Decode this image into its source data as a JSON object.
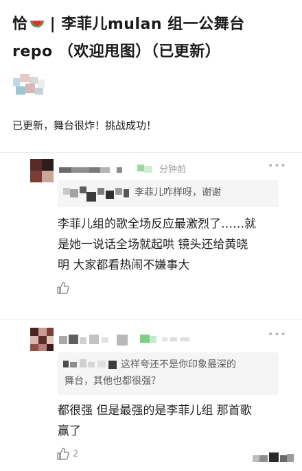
{
  "post": {
    "title_line1_pre": "恰",
    "title_line1_post": " | 李菲儿mulan 组一公舞台",
    "title_line2": "repo （欢迎甩图）（已更新）",
    "melon_icon": "watermelon-icon",
    "update_text": "已更新，舞台很炸！挑战成功！"
  },
  "comments": [
    {
      "time": "分钟前",
      "quote": "李菲儿咋样呀，谢谢",
      "text_line1": "李菲儿组的歌全场反应最激烈了……就",
      "text_line2": "是她一说话全场就起哄 镜头还给黄晓",
      "text_line3": "明 大家都看热闹不嫌事大",
      "like_icon": "thumbs-up-icon",
      "likes": ""
    },
    {
      "time": "",
      "quote_line1": "这样夸还不是你印象最深的",
      "quote_line2": "舞台，其他也都很强？",
      "text_line1": "都很强 但是最强的是李菲儿组 那首歌",
      "text_line2": "赢了",
      "like_icon": "thumbs-up-icon",
      "likes": "2"
    }
  ],
  "colors": {
    "accent_green": "#5cbf6a",
    "watermelon_red": "#e8413c",
    "muted": "#9a9a9a"
  }
}
